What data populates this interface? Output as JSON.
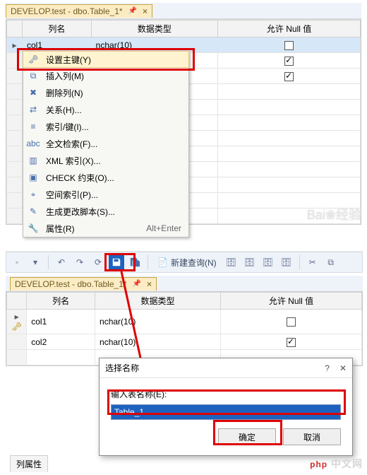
{
  "top": {
    "tab_title": "DEVELOP.test - dbo.Table_1*",
    "headers": {
      "name": "列名",
      "type": "数据类型",
      "null": "允许 Null 值"
    },
    "rows": [
      {
        "name": "col1",
        "type": "nchar(10)",
        "nullable": false,
        "selected": true
      }
    ]
  },
  "context_menu": {
    "items": [
      {
        "icon": "key",
        "label": "设置主键(Y)",
        "highlight": true
      },
      {
        "icon": "insert",
        "label": "插入列(M)"
      },
      {
        "icon": "delete",
        "label": "删除列(N)"
      },
      {
        "icon": "relation",
        "label": "关系(H)..."
      },
      {
        "icon": "index",
        "label": "索引/键(I)..."
      },
      {
        "icon": "fulltext",
        "label": "全文检索(F)..."
      },
      {
        "icon": "xml",
        "label": "XML 索引(X)..."
      },
      {
        "icon": "check",
        "label": "CHECK 约束(O)..."
      },
      {
        "icon": "spatial",
        "label": "空间索引(P)..."
      },
      {
        "icon": "script",
        "label": "生成更改脚本(S)..."
      },
      {
        "icon": "wrench",
        "label": "属性(R)",
        "shortcut": "Alt+Enter"
      }
    ]
  },
  "watermark": "Bai❀经验",
  "toolbar": {
    "new_query": "新建查询(N)"
  },
  "bottom": {
    "tab_title": "DEVELOP.test - dbo.Table_1*",
    "headers": {
      "name": "列名",
      "type": "数据类型",
      "null": "允许 Null 值"
    },
    "rows": [
      {
        "name": "col1",
        "type": "nchar(10)",
        "nullable": false,
        "pk": true
      },
      {
        "name": "col2",
        "type": "nchar(10)",
        "nullable": true
      }
    ],
    "col_props_title": "列属性"
  },
  "dialog": {
    "title": "选择名称",
    "label": "输入表名称(E):",
    "value": "Table_1",
    "ok": "确定",
    "cancel": "取消"
  },
  "brand": "php 中文网"
}
